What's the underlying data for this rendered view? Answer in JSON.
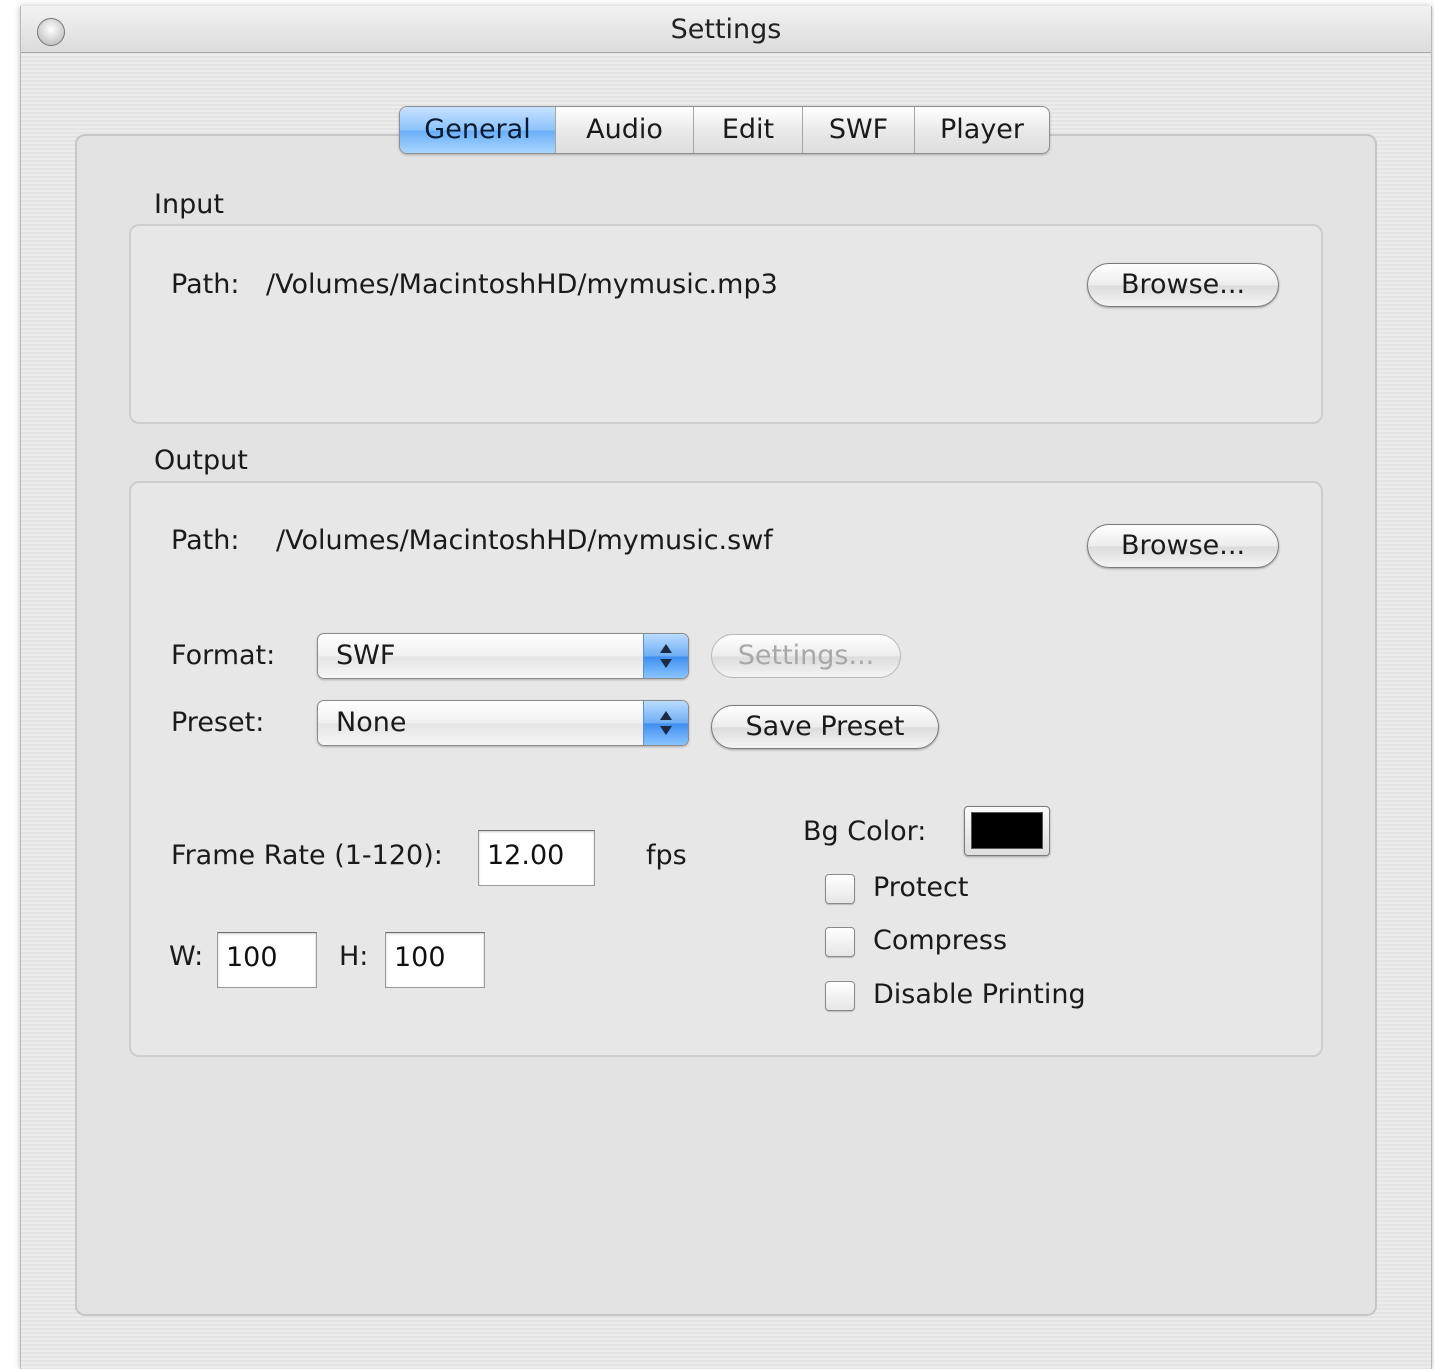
{
  "window": {
    "title": "Settings"
  },
  "tabs": [
    {
      "label": "General",
      "active": true
    },
    {
      "label": "Audio",
      "active": false
    },
    {
      "label": "Edit",
      "active": false
    },
    {
      "label": "SWF",
      "active": false
    },
    {
      "label": "Player",
      "active": false
    }
  ],
  "input": {
    "group_label": "Input",
    "path_label": "Path:",
    "path_value": "/Volumes/MacintoshHD/mymusic.mp3",
    "browse_label": "Browse..."
  },
  "output": {
    "group_label": "Output",
    "path_label": "Path:",
    "path_value": "/Volumes/MacintoshHD/mymusic.swf",
    "browse_label": "Browse...",
    "format_label": "Format:",
    "format_value": "SWF",
    "settings_label": "Settings...",
    "preset_label": "Preset:",
    "preset_value": "None",
    "save_preset_label": "Save Preset",
    "frame_rate_label": "Frame Rate (1-120):",
    "frame_rate_value": "12.00",
    "frame_rate_unit": "fps",
    "width_label": "W:",
    "width_value": "100",
    "height_label": "H:",
    "height_value": "100",
    "bg_color_label": "Bg Color:",
    "bg_color": "#000000",
    "checkboxes": [
      {
        "label": "Protect",
        "checked": false
      },
      {
        "label": "Compress",
        "checked": false
      },
      {
        "label": "Disable Printing",
        "checked": false
      }
    ]
  },
  "colors": {
    "active_tab": "#8cc3fb",
    "window_bg": "#e8e8e8"
  }
}
